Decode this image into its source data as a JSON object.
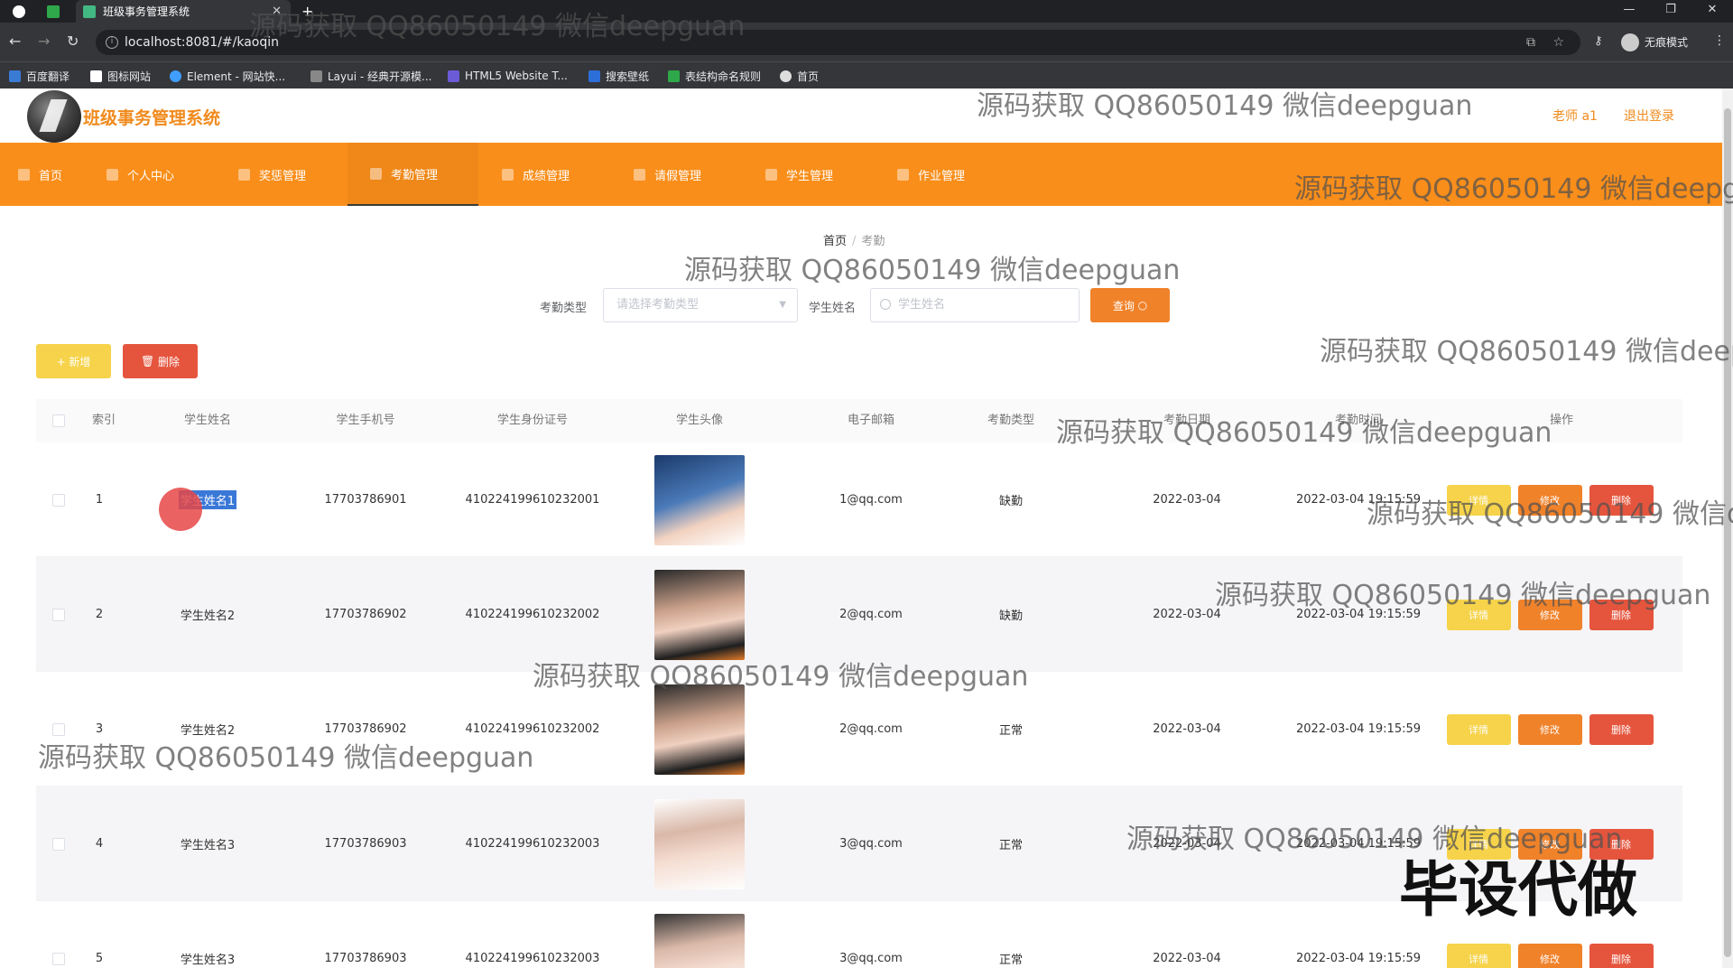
{
  "browser": {
    "tab_title": "班级事务管理系统",
    "url": "localhost:8081/#/kaoqin",
    "profile_label": "无痕模式",
    "bookmarks": [
      "百度翻译",
      "图标网站",
      "Element - 网站快...",
      "Layui - 经典开源模...",
      "HTML5 Website T...",
      "搜索壁纸",
      "表结构命名规则",
      "首页"
    ]
  },
  "header": {
    "title": "班级事务管理系统",
    "user": "老师 a1",
    "logout": "退出登录"
  },
  "nav": {
    "items": [
      "首页",
      "个人中心",
      "奖惩管理",
      "考勤管理",
      "成绩管理",
      "请假管理",
      "学生管理",
      "作业管理"
    ],
    "active_index": 3
  },
  "breadcrumb": {
    "home": "首页",
    "current": "考勤"
  },
  "search": {
    "type_label": "考勤类型",
    "type_placeholder": "请选择考勤类型",
    "name_label": "学生姓名",
    "name_placeholder": "学生姓名",
    "query_button": "查询"
  },
  "actions": {
    "add": "+ 新增",
    "delete": "删除"
  },
  "table": {
    "columns": [
      "索引",
      "学生姓名",
      "学生手机号",
      "学生身份证号",
      "学生头像",
      "电子邮箱",
      "考勤类型",
      "考勤日期",
      "考勤时间",
      "操作"
    ],
    "ops": {
      "detail": "详情",
      "edit": "修改",
      "remove": "删除"
    },
    "rows": [
      {
        "index": "1",
        "name": "学生姓名1",
        "phone": "17703786901",
        "id_card": "410224199610232001",
        "email": "1@qq.com",
        "type": "缺勤",
        "date": "2022-03-04",
        "time": "2022-03-04 19:15:59"
      },
      {
        "index": "2",
        "name": "学生姓名2",
        "phone": "17703786902",
        "id_card": "410224199610232002",
        "email": "2@qq.com",
        "type": "缺勤",
        "date": "2022-03-04",
        "time": "2022-03-04 19:15:59"
      },
      {
        "index": "3",
        "name": "学生姓名2",
        "phone": "17703786902",
        "id_card": "410224199610232002",
        "email": "2@qq.com",
        "type": "正常",
        "date": "2022-03-04",
        "time": "2022-03-04 19:15:59"
      },
      {
        "index": "4",
        "name": "学生姓名3",
        "phone": "17703786903",
        "id_card": "410224199610232003",
        "email": "3@qq.com",
        "type": "正常",
        "date": "2022-03-04",
        "time": "2022-03-04 19:15:59"
      },
      {
        "index": "5",
        "name": "学生姓名3",
        "phone": "17703786903",
        "id_card": "410224199610232003",
        "email": "3@qq.com",
        "type": "正常",
        "date": "2022-03-04",
        "time": "2022-03-04 19:15:59"
      }
    ]
  },
  "watermark": {
    "text": "源码获取 QQ86050149 微信deepguan",
    "text_cut_a": "源码获取 QQ86050149 微信deepg",
    "text_cut_b": "源码获取 QQ86050149 微信deep",
    "text_cut_c": "源码获取 QQ86050149 微信d",
    "big": "毕设代做"
  },
  "colors": {
    "brand": "#f98e1a",
    "query": "#f0822a",
    "add": "#f6d34a",
    "delete": "#e5553d"
  }
}
